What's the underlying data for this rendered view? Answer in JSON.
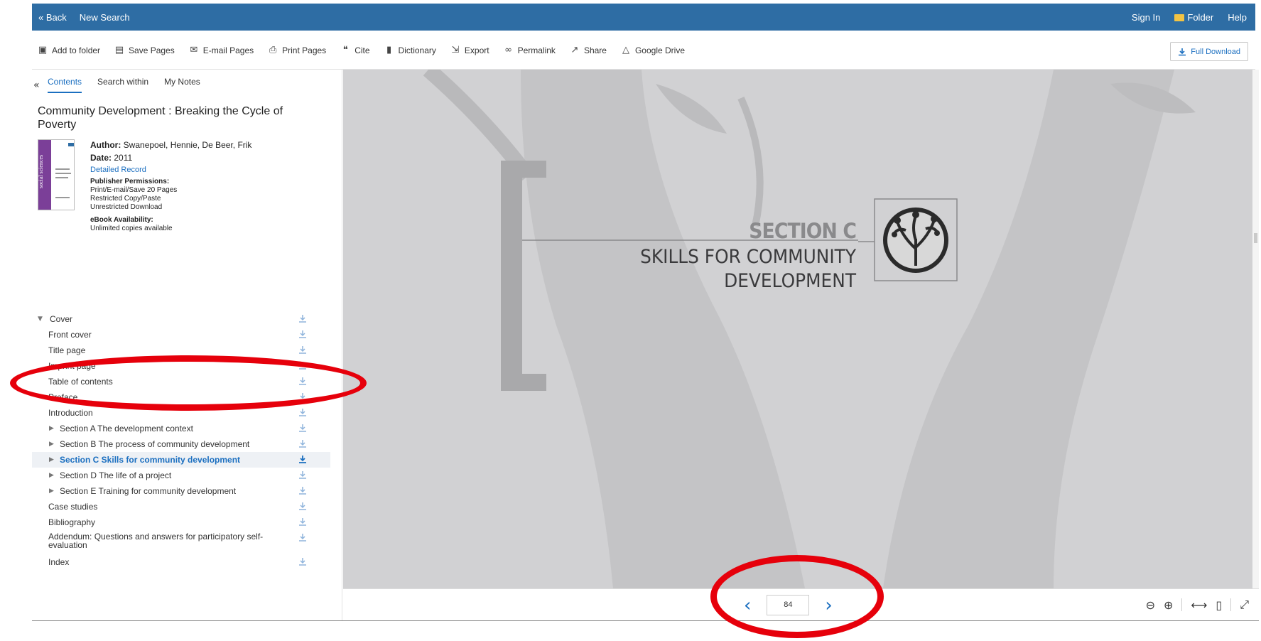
{
  "topbar": {
    "back": "« Back",
    "new_search": "New Search",
    "sign_in": "Sign In",
    "folder": "Folder",
    "help": "Help"
  },
  "toolbar": {
    "items": [
      {
        "label": "Add to folder",
        "icon": "folder-plus-icon"
      },
      {
        "label": "Save Pages",
        "icon": "save-icon"
      },
      {
        "label": "E-mail Pages",
        "icon": "email-icon"
      },
      {
        "label": "Print Pages",
        "icon": "print-icon"
      },
      {
        "label": "Cite",
        "icon": "cite-icon"
      },
      {
        "label": "Dictionary",
        "icon": "dictionary-icon"
      },
      {
        "label": "Export",
        "icon": "export-icon"
      },
      {
        "label": "Permalink",
        "icon": "link-icon"
      },
      {
        "label": "Share",
        "icon": "share-icon"
      },
      {
        "label": "Google Drive",
        "icon": "google-drive-icon"
      }
    ],
    "full_download": "Full Download"
  },
  "sidebar": {
    "tabs": [
      "Contents",
      "Search within",
      "My Notes"
    ],
    "book_title": "Community Development : Breaking the Cycle of Poverty",
    "cover_text": "social sciences",
    "author_label": "Author:",
    "author": "Swanepoel, Hennie, De Beer, Frik",
    "date_label": "Date:",
    "date": "2011",
    "detailed_record": "Detailed Record",
    "permissions_label": "Publisher Permissions:",
    "permissions": [
      "Print/E-mail/Save 20 Pages",
      "Restricted Copy/Paste",
      "Unrestricted Download"
    ],
    "availability_label": "eBook Availability:",
    "availability": "Unlimited copies available"
  },
  "toc": [
    {
      "label": "Cover",
      "level": 0,
      "caret": "down"
    },
    {
      "label": "Front cover",
      "level": 1
    },
    {
      "label": "Title page",
      "level": 1
    },
    {
      "label": "Imprint page",
      "level": 1
    },
    {
      "label": "Table of contents",
      "level": 1
    },
    {
      "label": "Preface",
      "level": 1
    },
    {
      "label": "Introduction",
      "level": 1
    },
    {
      "label": "Section A The development context",
      "level": 1,
      "caret": "right"
    },
    {
      "label": "Section B The process of community development",
      "level": 1,
      "caret": "right"
    },
    {
      "label": "Section C Skills for community development",
      "level": 1,
      "caret": "right",
      "selected": true
    },
    {
      "label": "Section D The life of a project",
      "level": 1,
      "caret": "right"
    },
    {
      "label": "Section E Training for community development",
      "level": 1,
      "caret": "right"
    },
    {
      "label": "Case studies",
      "level": 1
    },
    {
      "label": "Bibliography",
      "level": 1
    },
    {
      "label": "Addendum: Questions and answers for participatory self-evaluation",
      "level": 1,
      "double": true
    },
    {
      "label": "Index",
      "level": 1
    }
  ],
  "page": {
    "section": "SECTION C",
    "heading_line1": "SKILLS FOR COMMUNITY",
    "heading_line2": "DEVELOPMENT"
  },
  "pager": {
    "page_number": "84"
  },
  "colors": {
    "brand": "#2e6da4",
    "link": "#1b6fc0",
    "annotation": "#e6000b"
  }
}
